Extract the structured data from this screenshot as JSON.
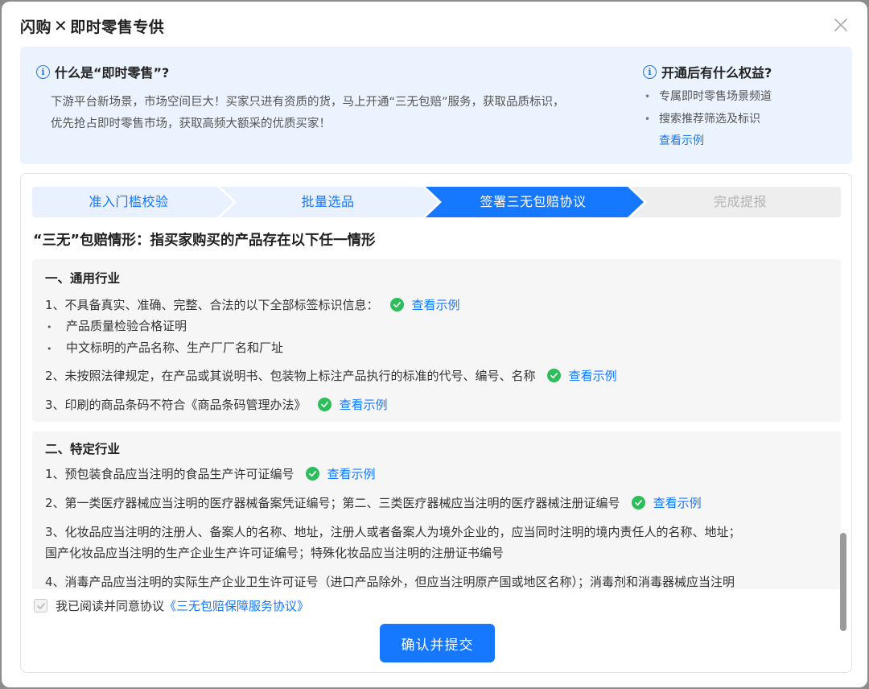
{
  "dialog": {
    "title_left": "闪购",
    "title_x": "✕",
    "title_right": "即时零售专供"
  },
  "banner": {
    "left_title": "什么是“即时零售”?",
    "left_desc_1": "下游平台新场景，市场空间巨大！买家只进有资质的货，马上开通“三无包赔”服务，获取品质标识，",
    "left_desc_2": "优先抢占即时零售市场，获取高频大额采的优质买家！",
    "right_title": "开通后有什么权益?",
    "right_items": [
      "专属即时零售场景频道",
      "搜索推荐筛选及标识"
    ],
    "right_link": "查看示例"
  },
  "steps": [
    {
      "label": "准入门槛校验",
      "state": "done"
    },
    {
      "label": "批量选品",
      "state": "done"
    },
    {
      "label": "签署三无包赔协议",
      "state": "active"
    },
    {
      "label": "完成提报",
      "state": "todo"
    }
  ],
  "content": {
    "heading": "“三无”包赔情形：指买家购买的产品存在以下任一情形",
    "general": {
      "title": "一、通用行业",
      "item1": "1、不具备真实、准确、完整、合法的以下全部标签标识信息：",
      "item1_link": "查看示例",
      "bullet1": "产品质量检验合格证明",
      "bullet2": "中文标明的产品名称、生产厂厂名和厂址",
      "item2": "2、未按照法律规定，在产品或其说明书、包装物上标注产品执行的标准的代号、编号、名称",
      "item2_link": "查看示例",
      "item3": "3、印刷的商品条码不符合《商品条码管理办法》",
      "item3_link": "查看示例"
    },
    "specific": {
      "title": "二、特定行业",
      "item1": "1、预包装食品应当注明的食品生产许可证编号",
      "item1_link": "查看示例",
      "item2": "2、第一类医疗器械应当注明的医疗器械备案凭证编号；第二、三类医疗器械应当注明的医疗器械注册证编号",
      "item2_link": "查看示例",
      "item3a": "3、化妆品应当注明的注册人、备案人的名称、地址，注册人或者备案人为境外企业的，应当同时注明的境内责任人的名称、地址；",
      "item3b": "国产化妆品应当注明的生产企业生产许可证编号；特殊化妆品应当注明的注册证书编号",
      "item4": "4、消毒产品应当注明的实际生产企业卫生许可证号（进口产品除外，但应当注明原产国或地区名称）；消毒剂和消毒器械应当注明"
    }
  },
  "agreement": {
    "text": "我已阅读并同意协议",
    "link": "《三无包赔保障服务协议》",
    "checked": true
  },
  "submit_label": "确认并提交",
  "colors": {
    "primary": "#1677ff",
    "banner_bg": "#eaf3fe",
    "step_done_bg": "#e8f1fd",
    "step_todo_bg": "#eeeeee",
    "check_green": "#2ebd5b"
  }
}
